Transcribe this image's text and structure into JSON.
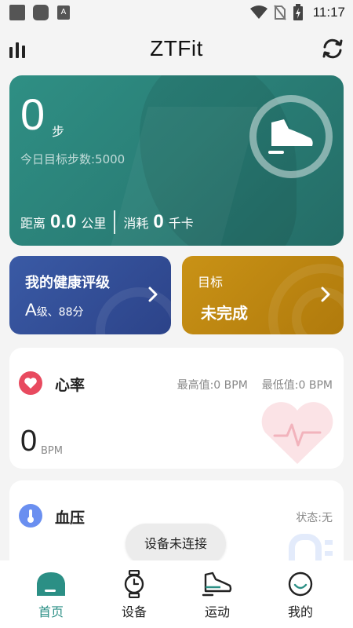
{
  "status_bar": {
    "time": "11:17"
  },
  "header": {
    "title": "ZTFit"
  },
  "steps": {
    "count": "0",
    "unit": "步",
    "goal_text": "今日目标步数:5000",
    "distance_label": "距离",
    "distance_value": "0.0",
    "distance_unit": "公里",
    "calorie_label": "消耗",
    "calorie_value": "0",
    "calorie_unit": "千卡"
  },
  "health_card": {
    "title": "我的健康评级",
    "grade": "A",
    "grade_suffix": "级、88分"
  },
  "goal_card": {
    "title": "目标",
    "value": "未完成"
  },
  "heart_rate": {
    "title": "心率",
    "max_text": "最高值:0  BPM",
    "min_text": "最低值:0  BPM",
    "value": "0",
    "unit": "BPM"
  },
  "blood_pressure": {
    "title": "血压",
    "status": "状态:无"
  },
  "toast": "设备未连接",
  "tabs": [
    {
      "label": "首页",
      "icon": "home-icon",
      "active": true
    },
    {
      "label": "设备",
      "icon": "watch-icon",
      "active": false
    },
    {
      "label": "运动",
      "icon": "shoe-icon",
      "active": false
    },
    {
      "label": "我的",
      "icon": "profile-icon",
      "active": false
    }
  ],
  "colors": {
    "teal": "#2b8f85",
    "health_blue": "#3a5aa5",
    "goal_gold": "#c99216",
    "heart_red": "#e84a5f",
    "bp_blue": "#6a8ff0"
  }
}
